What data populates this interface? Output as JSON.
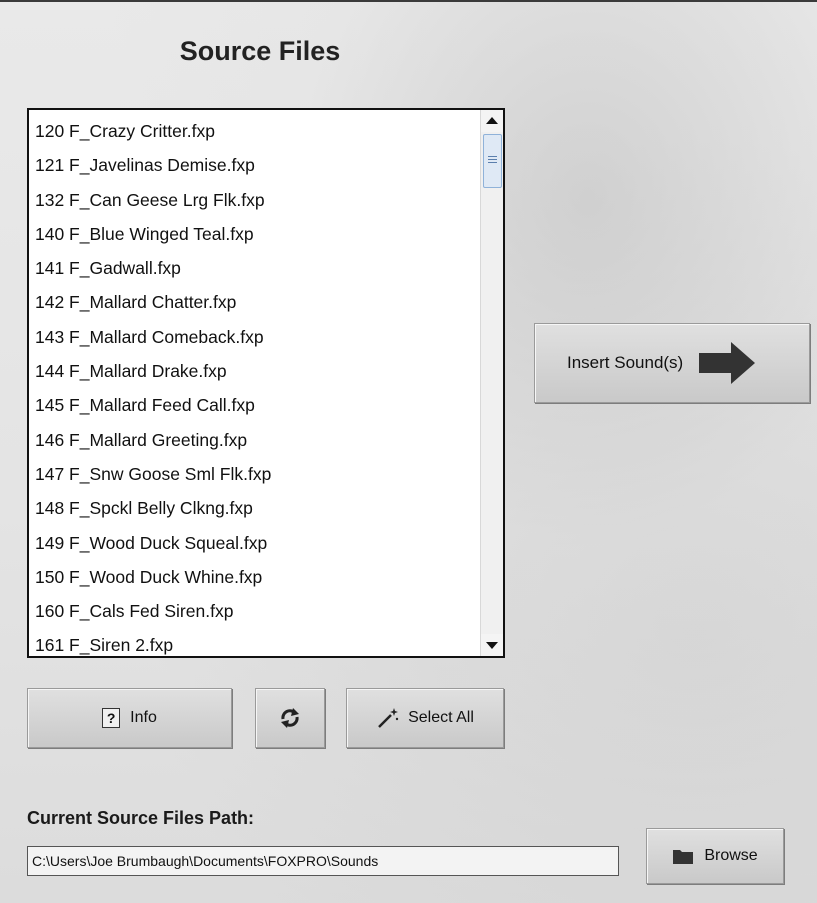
{
  "source": {
    "title": "Source Files",
    "files": [
      "120 F_Crazy Critter.fxp",
      "121 F_Javelinas Demise.fxp",
      "132 F_Can Geese Lrg Flk.fxp",
      "140 F_Blue Winged Teal.fxp",
      "141 F_Gadwall.fxp",
      "142 F_Mallard Chatter.fxp",
      "143 F_Mallard Comeback.fxp",
      "144 F_Mallard Drake.fxp",
      "145 F_Mallard Feed Call.fxp",
      "146 F_Mallard Greeting.fxp",
      "147 F_Snw Goose Sml Flk.fxp",
      "148 F_Spckl Belly Clkng.fxp",
      "149 F_Wood Duck Squeal.fxp",
      "150 F_Wood Duck Whine.fxp",
      "160 F_Cals Fed Siren.fxp",
      "161 F_Siren 2.fxp"
    ]
  },
  "actions": {
    "insert_label": "Insert Sound(s)",
    "info_label": "Info",
    "select_all_label": "Select All",
    "browse_label": "Browse"
  },
  "path": {
    "label": "Current Source Files Path:",
    "value": "C:\\Users\\Joe Brumbaugh\\Documents\\FOXPRO\\Sounds"
  },
  "icons": {
    "insert": "arrow-right-icon",
    "info": "question-icon",
    "refresh": "refresh-icon",
    "select_all": "magic-wand-icon",
    "browse": "folder-icon"
  }
}
